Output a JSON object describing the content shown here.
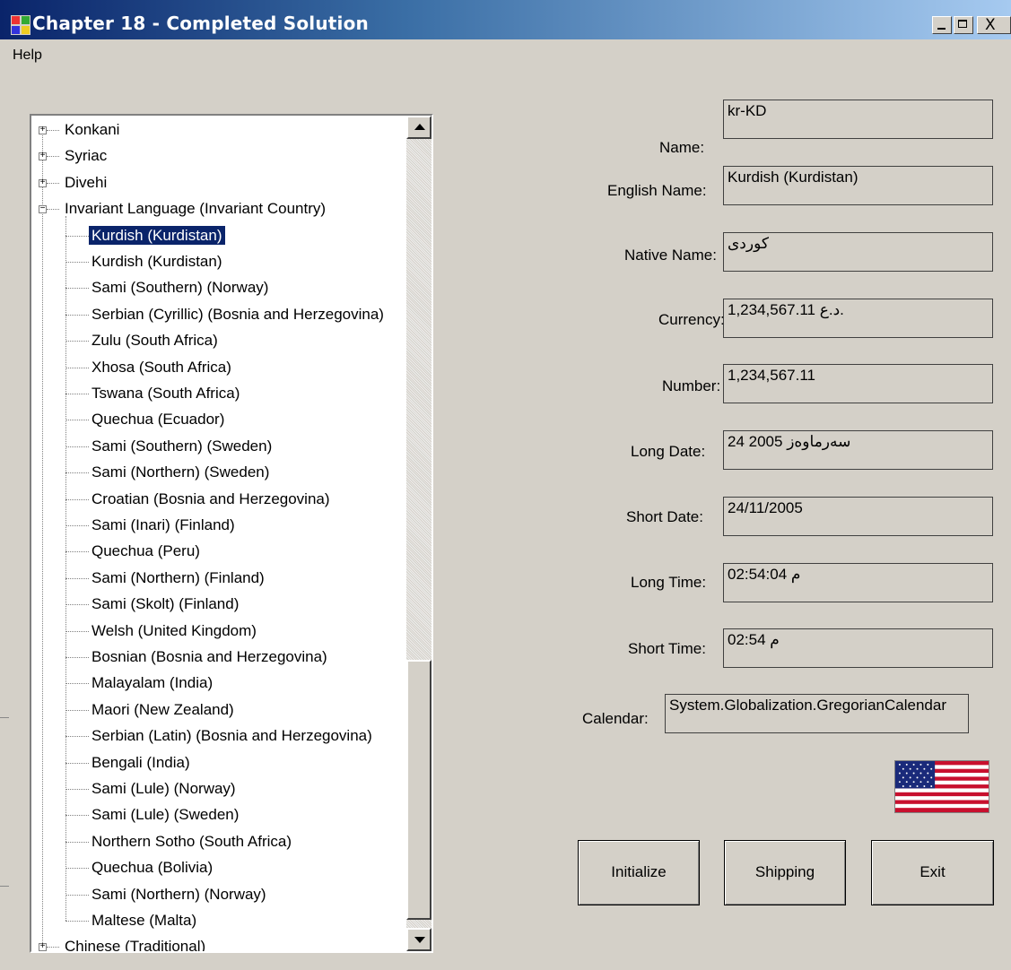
{
  "window": {
    "title": "Chapter 18 - Completed Solution",
    "caption_buttons": [
      "minimize",
      "maximize",
      "close"
    ]
  },
  "menu": {
    "items": [
      "Help"
    ]
  },
  "tree": {
    "nodes": [
      {
        "label": "Konkani",
        "level": 0,
        "expander": "+"
      },
      {
        "label": "Syriac",
        "level": 0,
        "expander": "+"
      },
      {
        "label": "Divehi",
        "level": 0,
        "expander": "+"
      },
      {
        "label": "Invariant Language (Invariant Country)",
        "level": 0,
        "expander": "-"
      },
      {
        "label": "Kurdish (Kurdistan)",
        "level": 1,
        "selected": true
      },
      {
        "label": "Kurdish (Kurdistan)",
        "level": 1
      },
      {
        "label": "Sami (Southern) (Norway)",
        "level": 1
      },
      {
        "label": "Serbian (Cyrillic) (Bosnia and Herzegovina)",
        "level": 1
      },
      {
        "label": "Zulu (South Africa)",
        "level": 1
      },
      {
        "label": "Xhosa (South Africa)",
        "level": 1
      },
      {
        "label": "Tswana (South Africa)",
        "level": 1
      },
      {
        "label": "Quechua (Ecuador)",
        "level": 1
      },
      {
        "label": "Sami (Southern) (Sweden)",
        "level": 1
      },
      {
        "label": "Sami (Northern) (Sweden)",
        "level": 1
      },
      {
        "label": "Croatian (Bosnia and Herzegovina)",
        "level": 1
      },
      {
        "label": "Sami (Inari) (Finland)",
        "level": 1
      },
      {
        "label": "Quechua (Peru)",
        "level": 1
      },
      {
        "label": "Sami (Northern) (Finland)",
        "level": 1
      },
      {
        "label": "Sami (Skolt) (Finland)",
        "level": 1
      },
      {
        "label": "Welsh (United Kingdom)",
        "level": 1
      },
      {
        "label": "Bosnian (Bosnia and Herzegovina)",
        "level": 1
      },
      {
        "label": "Malayalam (India)",
        "level": 1
      },
      {
        "label": "Maori (New Zealand)",
        "level": 1
      },
      {
        "label": "Serbian (Latin) (Bosnia and Herzegovina)",
        "level": 1
      },
      {
        "label": "Bengali (India)",
        "level": 1
      },
      {
        "label": "Sami (Lule) (Norway)",
        "level": 1
      },
      {
        "label": "Sami (Lule) (Sweden)",
        "level": 1
      },
      {
        "label": "Northern Sotho (South Africa)",
        "level": 1
      },
      {
        "label": "Quechua (Bolivia)",
        "level": 1
      },
      {
        "label": "Sami (Northern) (Norway)",
        "level": 1
      },
      {
        "label": "Maltese (Malta)",
        "level": 1
      },
      {
        "label": "Chinese (Traditional)",
        "level": 0,
        "expander": "+"
      }
    ]
  },
  "fields": {
    "name": {
      "label": "Name:",
      "value": "kr-KD"
    },
    "english_name": {
      "label": "English Name:",
      "value": "Kurdish (Kurdistan)"
    },
    "native_name": {
      "label": "Native Name:",
      "value": "کوردی"
    },
    "currency": {
      "label": "Currency:",
      "value": "1,234,567.11 د.ع."
    },
    "number": {
      "label": "Number:",
      "value": "1,234,567.11"
    },
    "long_date": {
      "label": "Long Date:",
      "value": "24 سەرماوەز 2005"
    },
    "short_date": {
      "label": "Short Date:",
      "value": "24/11/2005"
    },
    "long_time": {
      "label": "Long Time:",
      "value": "02:54:04 م"
    },
    "short_time": {
      "label": "Short Time:",
      "value": "02:54 م"
    },
    "calendar": {
      "label": "Calendar:",
      "value": "System.Globalization.GregorianCalendar"
    }
  },
  "flag": {
    "icon": "us-flag-icon"
  },
  "buttons": {
    "initialize": "Initialize",
    "shipping": "Shipping",
    "exit": "Exit"
  },
  "colors": {
    "window_bg": "#d4d0c8",
    "title_start": "#0a246a",
    "title_end": "#a6caf0",
    "selection": "#0a246a"
  }
}
